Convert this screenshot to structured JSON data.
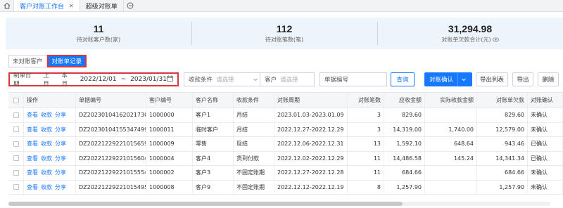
{
  "tabs": [
    {
      "label": "客户对账工作台",
      "active": true
    },
    {
      "label": "超级对账单",
      "active": false
    }
  ],
  "stats": [
    {
      "value": "11",
      "label": "待对账客户数(家)"
    },
    {
      "value": "112",
      "label": "待对账笔数(笔)"
    },
    {
      "value": "31,294.98",
      "label": "对账单欠款合计(元)"
    }
  ],
  "view_toggle": {
    "unreconciled": "未对账客户",
    "records": "对账单记录"
  },
  "filters": {
    "date_label": "制单日期",
    "last_month": "上月",
    "this_month": "本月",
    "date_start": "2022/12/01",
    "date_sep": "~",
    "date_end": "2023/01/31",
    "condition_label": "收款条件",
    "condition_placeholder": "请选择",
    "customer_label": "客户",
    "customer_placeholder": "请选择",
    "bill_no_label": "单据编号"
  },
  "buttons": {
    "query": "查询",
    "confirm": "对账确认",
    "export_list": "导出列表",
    "export": "导出",
    "delete": "删除"
  },
  "table": {
    "headers": [
      "操作",
      "单据编号",
      "客户编号",
      "客户名称",
      "收款条件",
      "对账周期",
      "对账笔数",
      "应收金额",
      "实际收款金额",
      "对账单欠款",
      "对账确认"
    ],
    "actions": [
      "查看",
      "收款",
      "分享"
    ],
    "rows": [
      {
        "bill_no": "DZ20230104162021730",
        "cust_no": "1000000",
        "cust_name": "客户1",
        "terms": "月结",
        "period": "2023.01.03-2023.01.09",
        "count": "3",
        "receivable": "829.60",
        "received": "",
        "owed": "829.60",
        "confirm": "未确认"
      },
      {
        "bill_no": "DZ20230104155347499",
        "cust_no": "1000011",
        "cust_name": "临时客户",
        "terms": "月结",
        "period": "2022.12.27-2022.12.29",
        "count": "3",
        "receivable": "14,319.00",
        "received": "1,740.00",
        "owed": "12,579.00",
        "confirm": "未确认"
      },
      {
        "bill_no": "DZ20221229221015659",
        "cust_no": "1000009",
        "cust_name": "零售",
        "terms": "现结",
        "period": "2022.12.06-2022.12.31",
        "count": "13",
        "receivable": "1,592.10",
        "received": "648.64",
        "owed": "943.46",
        "confirm": "已确认"
      },
      {
        "bill_no": "DZ20221229221015604",
        "cust_no": "1000004",
        "cust_name": "客户4",
        "terms": "货到付款",
        "period": "2022.12.02-2022.12.29",
        "count": "11",
        "receivable": "14,486.58",
        "received": "145.24",
        "owed": "14,341.34",
        "confirm": "已确认"
      },
      {
        "bill_no": "DZ20221229221015554",
        "cust_no": "1000002",
        "cust_name": "客户3",
        "terms": "不固定账期",
        "period": "2022.12.27-2022.12.28",
        "count": "11",
        "receivable": "684.66",
        "received": "",
        "owed": "684.66",
        "confirm": "未确认"
      },
      {
        "bill_no": "DZ20221229221015495",
        "cust_no": "1000008",
        "cust_name": "客户9",
        "terms": "不固定账期",
        "period": "2022.12.12-2022.12.19",
        "count": "8",
        "receivable": "1,257.90",
        "received": "",
        "owed": "1,257.90",
        "confirm": "未确认"
      }
    ]
  },
  "colors": {
    "accent": "#1677ff",
    "highlight_border": "#d9363e",
    "stats_bg": "#eef4fb"
  }
}
